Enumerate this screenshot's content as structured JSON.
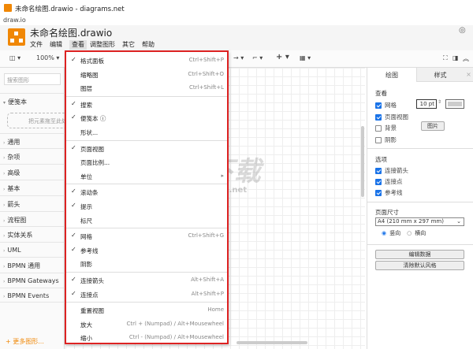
{
  "window": {
    "title": "未命名绘图.drawio - diagrams.net",
    "subtitle": "draw.io"
  },
  "header": {
    "doc_title": "未命名绘图.drawio",
    "menus": [
      "文件",
      "编辑",
      "查看",
      "调整图形",
      "其它",
      "帮助"
    ]
  },
  "toolbar": {
    "zoom": "100%"
  },
  "sidebar": {
    "search_placeholder": "搜索图形",
    "scratchpad": "便笺本",
    "scratch_drop": "把元素拖至此处",
    "items": [
      "通用",
      "杂项",
      "高级",
      "基本",
      "箭头",
      "流程图",
      "实体关系",
      "UML",
      "BPMN 通用",
      "BPMN Gateways",
      "BPMN Events"
    ],
    "more": "+ 更多图形..."
  },
  "menu": {
    "groups": [
      [
        {
          "label": "格式面板",
          "checked": true,
          "shortcut": "Ctrl+Shift+P"
        },
        {
          "label": "缩略图",
          "checked": false,
          "shortcut": "Ctrl+Shift+O"
        },
        {
          "label": "图层",
          "checked": false,
          "shortcut": "Ctrl+Shift+L"
        }
      ],
      [
        {
          "label": "搜索",
          "checked": true,
          "shortcut": ""
        },
        {
          "label": "便笺本 ⓘ",
          "checked": true,
          "shortcut": ""
        },
        {
          "label": "形状...",
          "checked": false,
          "shortcut": ""
        }
      ],
      [
        {
          "label": "页面视图",
          "checked": true,
          "shortcut": ""
        },
        {
          "label": "页面比例...",
          "checked": false,
          "shortcut": ""
        },
        {
          "label": "单位",
          "checked": false,
          "shortcut": "▸"
        }
      ],
      [
        {
          "label": "滚动条",
          "checked": true,
          "shortcut": ""
        },
        {
          "label": "提示",
          "checked": true,
          "shortcut": ""
        },
        {
          "label": "标尺",
          "checked": false,
          "shortcut": ""
        }
      ],
      [
        {
          "label": "网格",
          "checked": true,
          "shortcut": "Ctrl+Shift+G"
        },
        {
          "label": "参考线",
          "checked": true,
          "shortcut": ""
        },
        {
          "label": "阴影",
          "checked": false,
          "shortcut": ""
        }
      ],
      [
        {
          "label": "连接箭头",
          "checked": true,
          "shortcut": "Alt+Shift+A"
        },
        {
          "label": "连接点",
          "checked": true,
          "shortcut": "Alt+Shift+P"
        }
      ],
      [
        {
          "label": "重置视图",
          "checked": false,
          "shortcut": "Home"
        },
        {
          "label": "放大",
          "checked": false,
          "shortcut": "Ctrl + (Numpad) / Alt+Mousewheel"
        },
        {
          "label": "缩小",
          "checked": false,
          "shortcut": "Ctrl - (Numpad) / Alt+Mousewheel"
        }
      ]
    ]
  },
  "panel": {
    "tabs": [
      "绘图",
      "样式"
    ],
    "view_title": "查看",
    "grid": "网格",
    "grid_size": "10 pt",
    "page_view": "页面视图",
    "background": "背景",
    "image_btn": "图片",
    "shadow": "阴影",
    "options_title": "选项",
    "conn_arrows": "连接箭头",
    "conn_points": "连接点",
    "guides": "参考线",
    "page_size_title": "页面尺寸",
    "page_size": "A4 (210 mm x 297 mm)",
    "portrait": "竖向",
    "landscape": "横向",
    "edit_data": "编辑数据",
    "clear_style": "清除默认风格"
  },
  "watermark": {
    "brand": "KK下载",
    "url": "www.kkx.net"
  }
}
